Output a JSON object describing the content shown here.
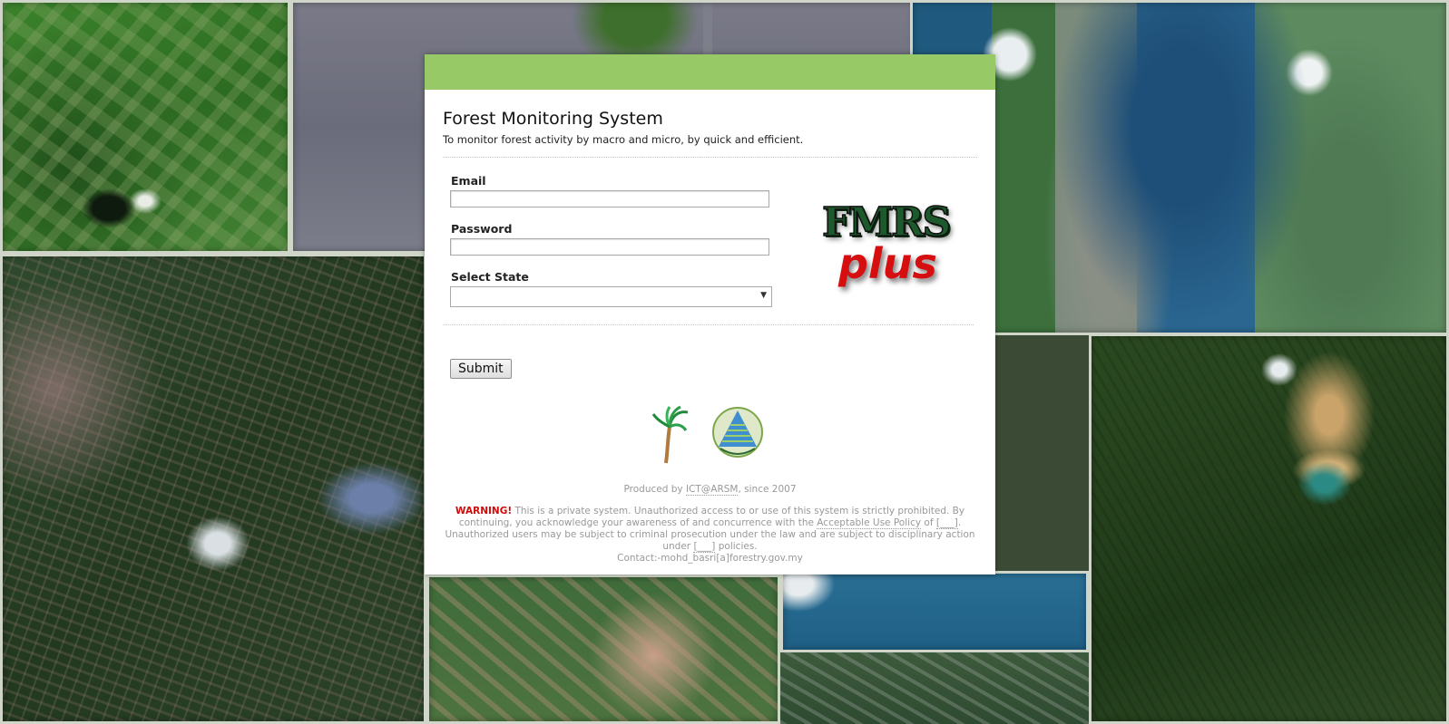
{
  "panel": {
    "title": "Forest Monitoring System",
    "subtitle": "To monitor forest activity by macro and micro, by quick and efficient."
  },
  "form": {
    "email_label": "Email",
    "email_value": "",
    "password_label": "Password",
    "password_value": "",
    "state_label": "Select State",
    "state_selected": "",
    "submit_label": "Submit"
  },
  "logo": {
    "line1": "FMRS",
    "line2": "plus"
  },
  "footer": {
    "produced_prefix": "Produced by ",
    "produced_link": "ICT@ARSM",
    "produced_suffix": ", since 2007",
    "warning_label": "WARNING!",
    "warning_part1": " This is a private system. Unauthorized access to or use of this system is strictly prohibited. By continuing, you acknowledge your awareness of and concurrence with the ",
    "aup_link": "Acceptable Use Policy",
    "warning_part2": " of ",
    "blank_link_1": "[___]",
    "warning_part3": ". Unauthorized users may be subject to criminal prosecution under the law and are subject to disciplinary action under ",
    "blank_link_2": "[___]",
    "warning_part4": " policies.",
    "contact": "Contact:-mohd_basri[a]forestry.gov.my"
  },
  "colors": {
    "header_green": "#97c966",
    "warning_red": "#d10a0a",
    "logo_green": "#1c5a2b",
    "logo_red": "#d60e10"
  },
  "icons": [
    "dropdown-arrow-icon",
    "palm-logo-icon",
    "arsm-logo-icon",
    "fmrs-plus-logo"
  ]
}
